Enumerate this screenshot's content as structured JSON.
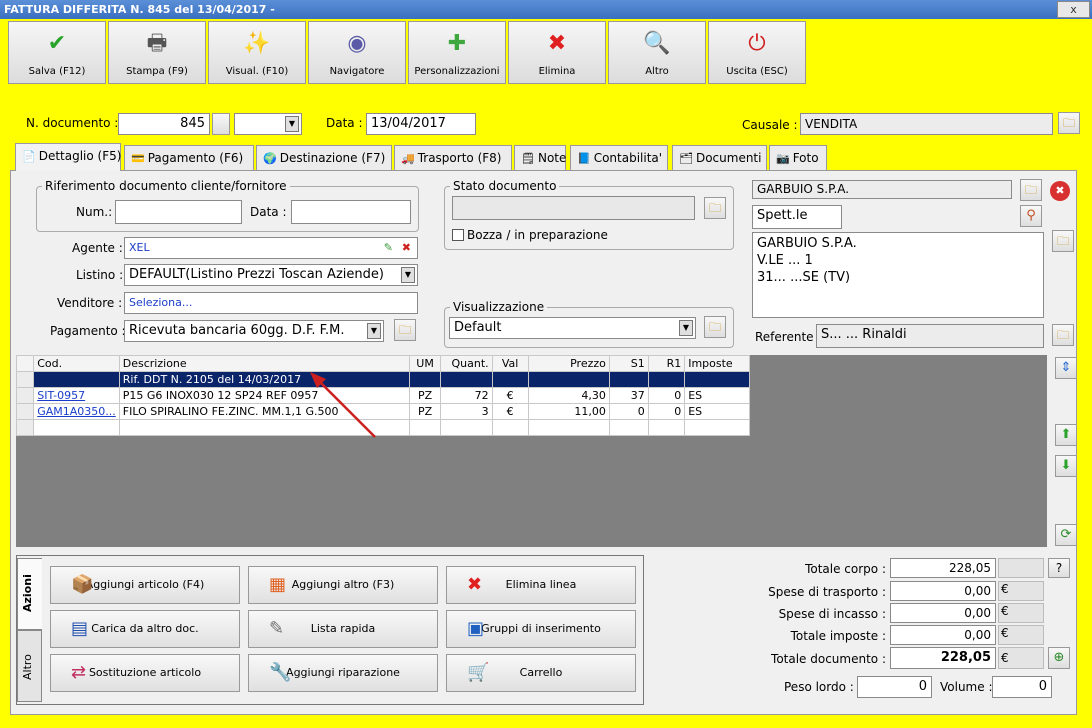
{
  "window": {
    "title": "FATTURA DIFFERITA N. 845 del 13/04/2017 -",
    "close": "x"
  },
  "toolbar": [
    {
      "label": "Salva (F12)",
      "icon": "✔",
      "color": "#2aa32a",
      "name": "save-button",
      "iname": "checkmark-icon"
    },
    {
      "label": "Stampa (F9)",
      "icon": "🖶",
      "color": "#555555",
      "name": "print-button",
      "iname": "printer-icon"
    },
    {
      "label": "Visual. (F10)",
      "icon": "✨",
      "color": "#d4a000",
      "name": "preview-button",
      "iname": "magic-wand-icon"
    },
    {
      "label": "Navigatore",
      "icon": "◉",
      "color": "#5a5aa8",
      "name": "navigator-button",
      "iname": "compass-icon"
    },
    {
      "label": "Personalizzazioni",
      "icon": "✚",
      "color": "#3ea83e",
      "name": "customize-button",
      "iname": "puzzle-icon"
    },
    {
      "label": "Elimina",
      "icon": "✖",
      "color": "#e02020",
      "name": "delete-button",
      "iname": "delete-x-icon"
    },
    {
      "label": "Altro",
      "icon": "🔍",
      "color": "#2060c0",
      "name": "more-button",
      "iname": "magnifier-icon"
    },
    {
      "label": "Uscita (ESC)",
      "icon": "⏻",
      "color": "#d02020",
      "name": "exit-button",
      "iname": "power-icon"
    }
  ],
  "header": {
    "ndoc_label": "N. documento :",
    "ndoc_value": "845",
    "data_label": "Data :",
    "data_value": "13/04/2017",
    "causale_label": "Causale :",
    "causale_value": "VENDITA"
  },
  "tabs": [
    "Dettaglio (F5)",
    "Pagamento (F6)",
    "Destinazione (F7)",
    "Trasporto (F8)",
    "Note",
    "Contabilita'",
    "Documenti",
    "Foto"
  ],
  "rif": {
    "title": "Riferimento documento cliente/fornitore",
    "num_label": "Num.:",
    "data_label": "Data :"
  },
  "fields": {
    "agente_label": "Agente :",
    "agente_value": "XEL",
    "listino_label": "Listino :",
    "listino_value": "DEFAULT(Listino Prezzi Toscan Aziende)",
    "venditore_label": "Venditore :",
    "venditore_value": "Seleziona...",
    "pagamento_label": "Pagamento :",
    "pagamento_value": "Ricevuta bancaria 60gg. D.F. F.M."
  },
  "stato": {
    "title": "Stato documento",
    "bozza_label": "Bozza / in preparazione"
  },
  "visualizzazione": {
    "title": "Visualizzazione",
    "value": "Default"
  },
  "cliente": {
    "name": "GARBUIO S.P.A.",
    "salutation": "Spett.le",
    "addr1": "GARBUIO S.P.A.",
    "addr2": "V.LE ... 1",
    "addr3": "31... ...SE (TV)",
    "referente_label": "Referente",
    "referente_value": "S... ... Rinaldi"
  },
  "grid": {
    "columns": [
      "Cod.",
      "Descrizione",
      "UM",
      "Quant.",
      "Val",
      "Prezzo",
      "S1",
      "R1",
      "Imposte"
    ],
    "rows": [
      {
        "cod": "",
        "desc": "Rif. DDT N. 2105 del 14/03/2017",
        "um": "",
        "qty": "",
        "val": "",
        "price": "",
        "s1": "",
        "r1": "",
        "tax": "",
        "selected": true
      },
      {
        "cod": "SIT-0957",
        "desc": "P15 G6 INOX030 12 SP24 REF 0957",
        "um": "PZ",
        "qty": "72",
        "val": "€",
        "price": "4,30",
        "s1": "37",
        "r1": "0",
        "tax": "ES",
        "selected": false
      },
      {
        "cod": "GAM1A0350...",
        "desc": "FILO SPIRALINO FE.ZINC. MM.1,1 G.500",
        "um": "PZ",
        "qty": "3",
        "val": "€",
        "price": "11,00",
        "s1": "0",
        "r1": "0",
        "tax": "ES",
        "selected": false
      },
      {
        "cod": "",
        "desc": "",
        "um": "",
        "qty": "",
        "val": "",
        "price": "",
        "s1": "",
        "r1": "",
        "tax": "",
        "selected": false
      }
    ]
  },
  "actions": {
    "tab_azioni": "Azioni",
    "tab_altro": "Altro",
    "buttons": [
      {
        "label": "Aggiungi articolo (F4)",
        "icon": "📦",
        "name": "add-article-button",
        "iname": "box-add-icon"
      },
      {
        "label": "Aggiungi altro (F3)",
        "icon": "▦",
        "name": "add-other-button",
        "iname": "grid-add-icon"
      },
      {
        "label": "Elimina linea",
        "icon": "✖",
        "name": "delete-line-button",
        "iname": "delete-x-icon"
      },
      {
        "label": "Carica da altro doc.",
        "icon": "▤",
        "name": "load-from-doc-button",
        "iname": "list-check-icon"
      },
      {
        "label": "Lista rapida",
        "icon": "✎",
        "name": "quick-list-button",
        "iname": "hand-list-icon"
      },
      {
        "label": "Gruppi di inserimento",
        "icon": "▣",
        "name": "insert-groups-button",
        "iname": "group-add-icon"
      },
      {
        "label": "Sostituzione articolo",
        "icon": "⇄",
        "name": "replace-article-button",
        "iname": "swap-shapes-icon"
      },
      {
        "label": "Aggiungi riparazione",
        "icon": "🔧",
        "name": "add-repair-button",
        "iname": "wrench-icon"
      },
      {
        "label": "Carrello",
        "icon": "🛒",
        "name": "cart-button",
        "iname": "cart-icon"
      }
    ]
  },
  "totals": {
    "corpo_label": "Totale corpo :",
    "corpo_value": "228,05",
    "help": "?",
    "trasporto_label": "Spese di trasporto :",
    "trasporto_value": "0,00",
    "incasso_label": "Spese di incasso :",
    "incasso_value": "0,00",
    "imposte_label": "Totale imposte :",
    "imposte_value": "0,00",
    "documento_label": "Totale documento :",
    "documento_value": "228,05",
    "currency": "€",
    "peso_label": "Peso lordo :",
    "peso_value": "0",
    "volume_label": "Volume :",
    "volume_value": "0"
  }
}
